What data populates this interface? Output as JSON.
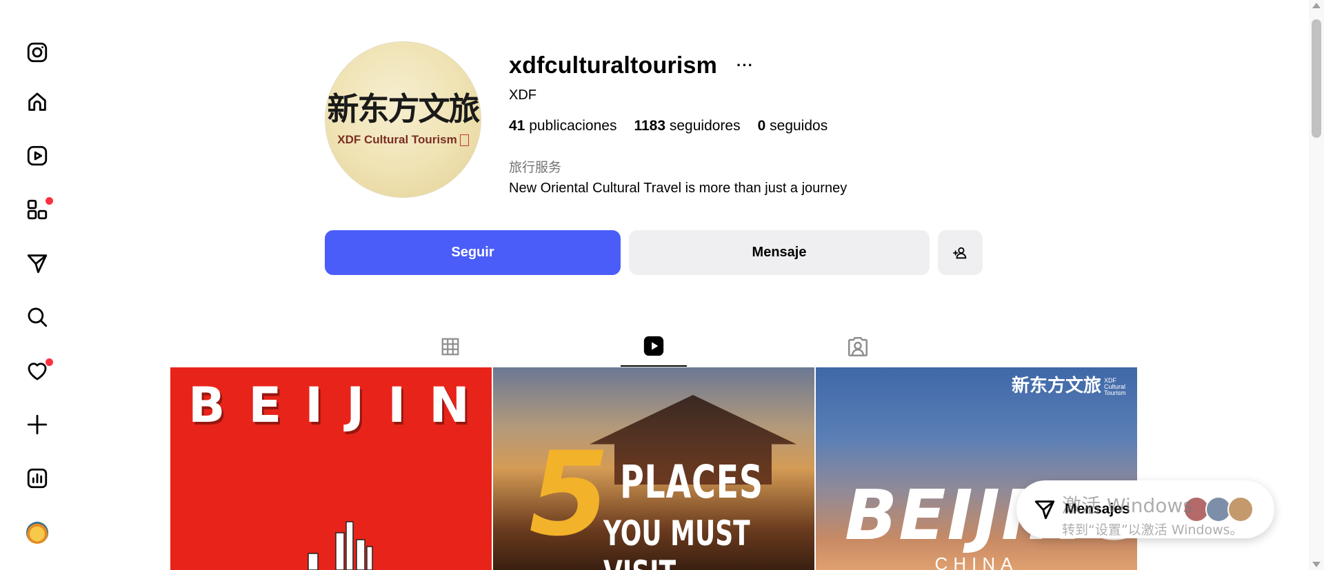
{
  "sidebar": {
    "items": [
      {
        "name": "instagram-logo-icon"
      },
      {
        "name": "home-icon"
      },
      {
        "name": "reels-icon"
      },
      {
        "name": "explore-apps-icon",
        "badge": true
      },
      {
        "name": "messages-send-icon"
      },
      {
        "name": "search-icon"
      },
      {
        "name": "notifications-heart-icon",
        "badge": true
      },
      {
        "name": "create-plus-icon"
      },
      {
        "name": "dashboard-chart-icon"
      },
      {
        "name": "profile-avatar-icon"
      }
    ],
    "badge_color": "#ff3040"
  },
  "profile": {
    "logo_cn": "新东方文旅",
    "logo_en": "XDF Cultural Tourism",
    "username": "xdfculturaltourism",
    "more": "···",
    "full_name": "XDF",
    "posts_count": "41",
    "posts_label": "publicaciones",
    "followers_count": "1183",
    "followers_label": "seguidores",
    "following_count": "0",
    "following_label": "seguidos",
    "category": "旅行服务",
    "bio": "New Oriental Cultural Travel is more than just a journey"
  },
  "actions": {
    "follow_label": "Seguir",
    "message_label": "Mensaje",
    "follow_color": "#4a5df9"
  },
  "tabs": [
    {
      "name": "tab-posts-grid",
      "icon": "grid-icon",
      "active": false
    },
    {
      "name": "tab-reels",
      "icon": "reels-play-icon",
      "active": true
    },
    {
      "name": "tab-tagged",
      "icon": "tagged-user-icon",
      "active": false
    }
  ],
  "grid": {
    "cell1_title": "BEIJING",
    "cell2_number": "5",
    "cell2_line1": "PLACES",
    "cell2_line2": "YOU MUST VISIT",
    "cell3_watermark": "新东方文旅",
    "cell3_watermark_en": "XDF Cultural Tourism",
    "cell3_title": "BEIJING",
    "cell3_sub": "CHINA"
  },
  "messages_pill": {
    "label": "Mensajes"
  },
  "watermark": {
    "line1": "激活 Windows",
    "line2": "转到“设置”以激活 Windows。"
  }
}
